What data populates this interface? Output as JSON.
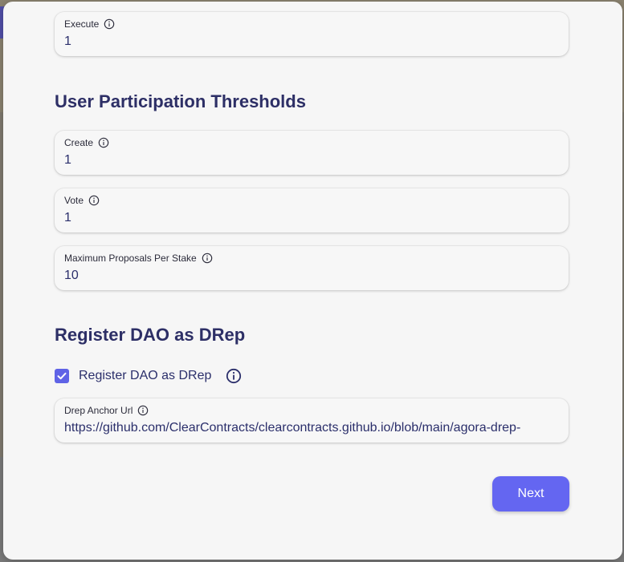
{
  "fields_top": {
    "execute": {
      "label": "Execute",
      "value": "1"
    }
  },
  "user_participation": {
    "title": "User Participation Thresholds",
    "create": {
      "label": "Create",
      "value": "1"
    },
    "vote": {
      "label": "Vote",
      "value": "1"
    },
    "max_proposals": {
      "label": "Maximum Proposals Per Stake",
      "value": "10"
    }
  },
  "drep": {
    "title": "Register DAO as DRep",
    "checkbox_label": "Register DAO as DRep",
    "checked": true,
    "anchor_url": {
      "label": "Drep Anchor Url",
      "value": "https://github.com/ClearContracts/clearcontracts.github.io/blob/main/agora-drep-"
    }
  },
  "footer": {
    "next_label": "Next"
  },
  "colors": {
    "accent": "#6466f1",
    "title": "#2d2f66"
  },
  "icons": {
    "info": "info-circle-icon",
    "check": "check-icon"
  }
}
